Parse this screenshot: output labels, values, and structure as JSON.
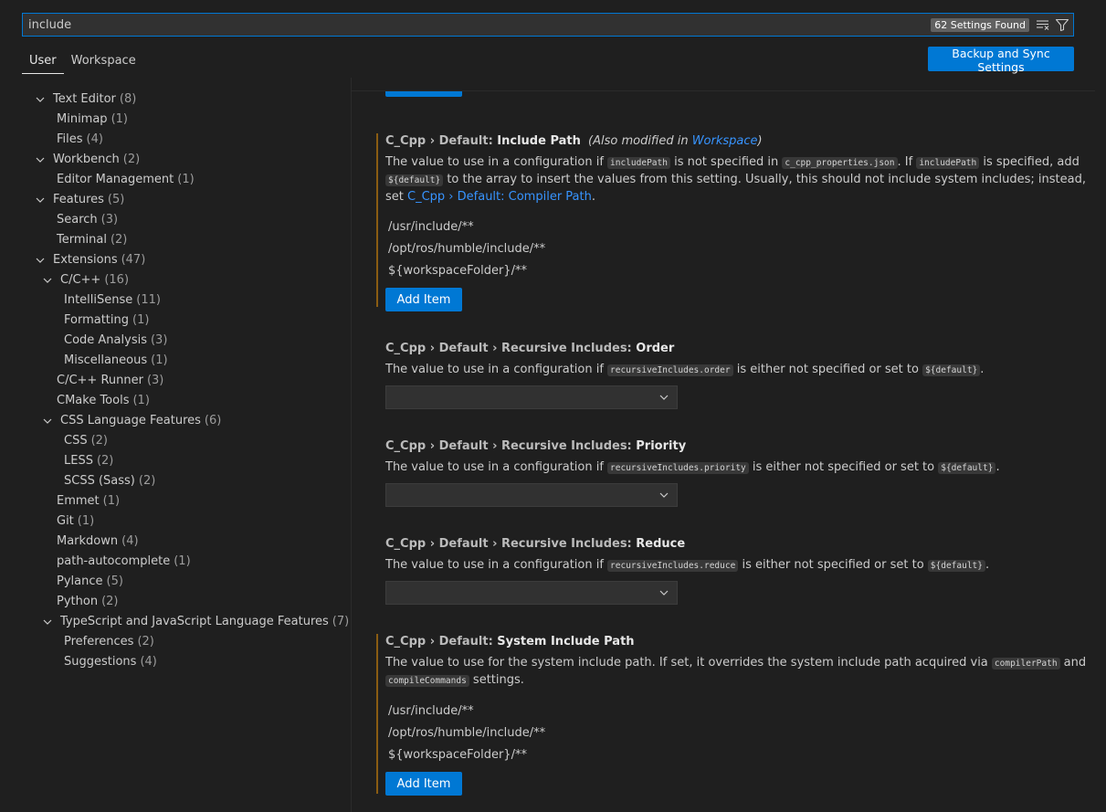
{
  "search": {
    "value": "include",
    "count": "62 Settings Found"
  },
  "tabs": [
    {
      "label": "User"
    },
    {
      "label": "Workspace"
    }
  ],
  "sync_button": "Backup and Sync Settings",
  "toc": [
    {
      "label": "Text Editor",
      "count": "(8)"
    },
    {
      "label": "Minimap",
      "count": "(1)"
    },
    {
      "label": "Files",
      "count": "(4)"
    },
    {
      "label": "Workbench",
      "count": "(2)"
    },
    {
      "label": "Editor Management",
      "count": "(1)"
    },
    {
      "label": "Features",
      "count": "(5)"
    },
    {
      "label": "Search",
      "count": "(3)"
    },
    {
      "label": "Terminal",
      "count": "(2)"
    },
    {
      "label": "Extensions",
      "count": "(47)"
    },
    {
      "label": "C/C++",
      "count": "(16)"
    },
    {
      "label": "IntelliSense",
      "count": "(11)"
    },
    {
      "label": "Formatting",
      "count": "(1)"
    },
    {
      "label": "Code Analysis",
      "count": "(3)"
    },
    {
      "label": "Miscellaneous",
      "count": "(1)"
    },
    {
      "label": "C/C++ Runner",
      "count": "(3)"
    },
    {
      "label": "CMake Tools",
      "count": "(1)"
    },
    {
      "label": "CSS Language Features",
      "count": "(6)"
    },
    {
      "label": "CSS",
      "count": "(2)"
    },
    {
      "label": "LESS",
      "count": "(2)"
    },
    {
      "label": "SCSS (Sass)",
      "count": "(2)"
    },
    {
      "label": "Emmet",
      "count": "(1)"
    },
    {
      "label": "Git",
      "count": "(1)"
    },
    {
      "label": "Markdown",
      "count": "(4)"
    },
    {
      "label": "path-autocomplete",
      "count": "(1)"
    },
    {
      "label": "Pylance",
      "count": "(5)"
    },
    {
      "label": "Python",
      "count": "(2)"
    },
    {
      "label": "TypeScript and JavaScript Language Features",
      "count": "(7)"
    },
    {
      "label": "Preferences",
      "count": "(2)"
    },
    {
      "label": "Suggestions",
      "count": "(4)"
    }
  ],
  "settings": {
    "include_path": {
      "category": "C_Cpp › Default: ",
      "key": "Include Path",
      "note_prefix": "(Also modified in ",
      "note_link": "Workspace",
      "note_suffix": ")",
      "desc": {
        "t1": "The value to use in a configuration if ",
        "c1": "includePath",
        "t2": " is not specified in ",
        "c2": "c_cpp_properties.json",
        "t3": ". If ",
        "c3": "includePath",
        "t4": " is specified, add ",
        "c4": "${default}",
        "t5": " to the array to insert the values from this setting. Usually, this should not include system includes; instead, set ",
        "link": "C_Cpp › Default: Compiler Path",
        "t6": "."
      },
      "items": [
        "/usr/include/**",
        "/opt/ros/humble/include/**",
        "${workspaceFolder}/**"
      ],
      "add_label": "Add Item"
    },
    "order": {
      "category": "C_Cpp › Default › Recursive Includes: ",
      "key": "Order",
      "t1": "The value to use in a configuration if ",
      "c1": "recursiveIncludes.order",
      "t2": " is either not specified or set to ",
      "c2": "${default}",
      "t3": ".",
      "value": ""
    },
    "priority": {
      "category": "C_Cpp › Default › Recursive Includes: ",
      "key": "Priority",
      "t1": "The value to use in a configuration if ",
      "c1": "recursiveIncludes.priority",
      "t2": " is either not specified or set to ",
      "c2": "${default}",
      "t3": ".",
      "value": ""
    },
    "reduce": {
      "category": "C_Cpp › Default › Recursive Includes: ",
      "key": "Reduce",
      "t1": "The value to use in a configuration if ",
      "c1": "recursiveIncludes.reduce",
      "t2": " is either not specified or set to ",
      "c2": "${default}",
      "t3": ".",
      "value": ""
    },
    "system_include": {
      "category": "C_Cpp › Default: ",
      "key": "System Include Path",
      "t1": "The value to use for the system include path. If set, it overrides the system include path acquired via ",
      "c1": "compilerPath",
      "t2": " and ",
      "c2": "compileCommands",
      "t3": " settings.",
      "items": [
        "/usr/include/**",
        "/opt/ros/humble/include/**",
        "${workspaceFolder}/**"
      ],
      "add_label": "Add Item"
    }
  },
  "colors": {
    "accent": "#0078d4",
    "modified_bar": "#8a5c12",
    "link": "#3794ff",
    "background": "#1f1f1f"
  },
  "icons": [
    "clear-filter-icon",
    "filter-icon",
    "chevron-down-icon"
  ]
}
